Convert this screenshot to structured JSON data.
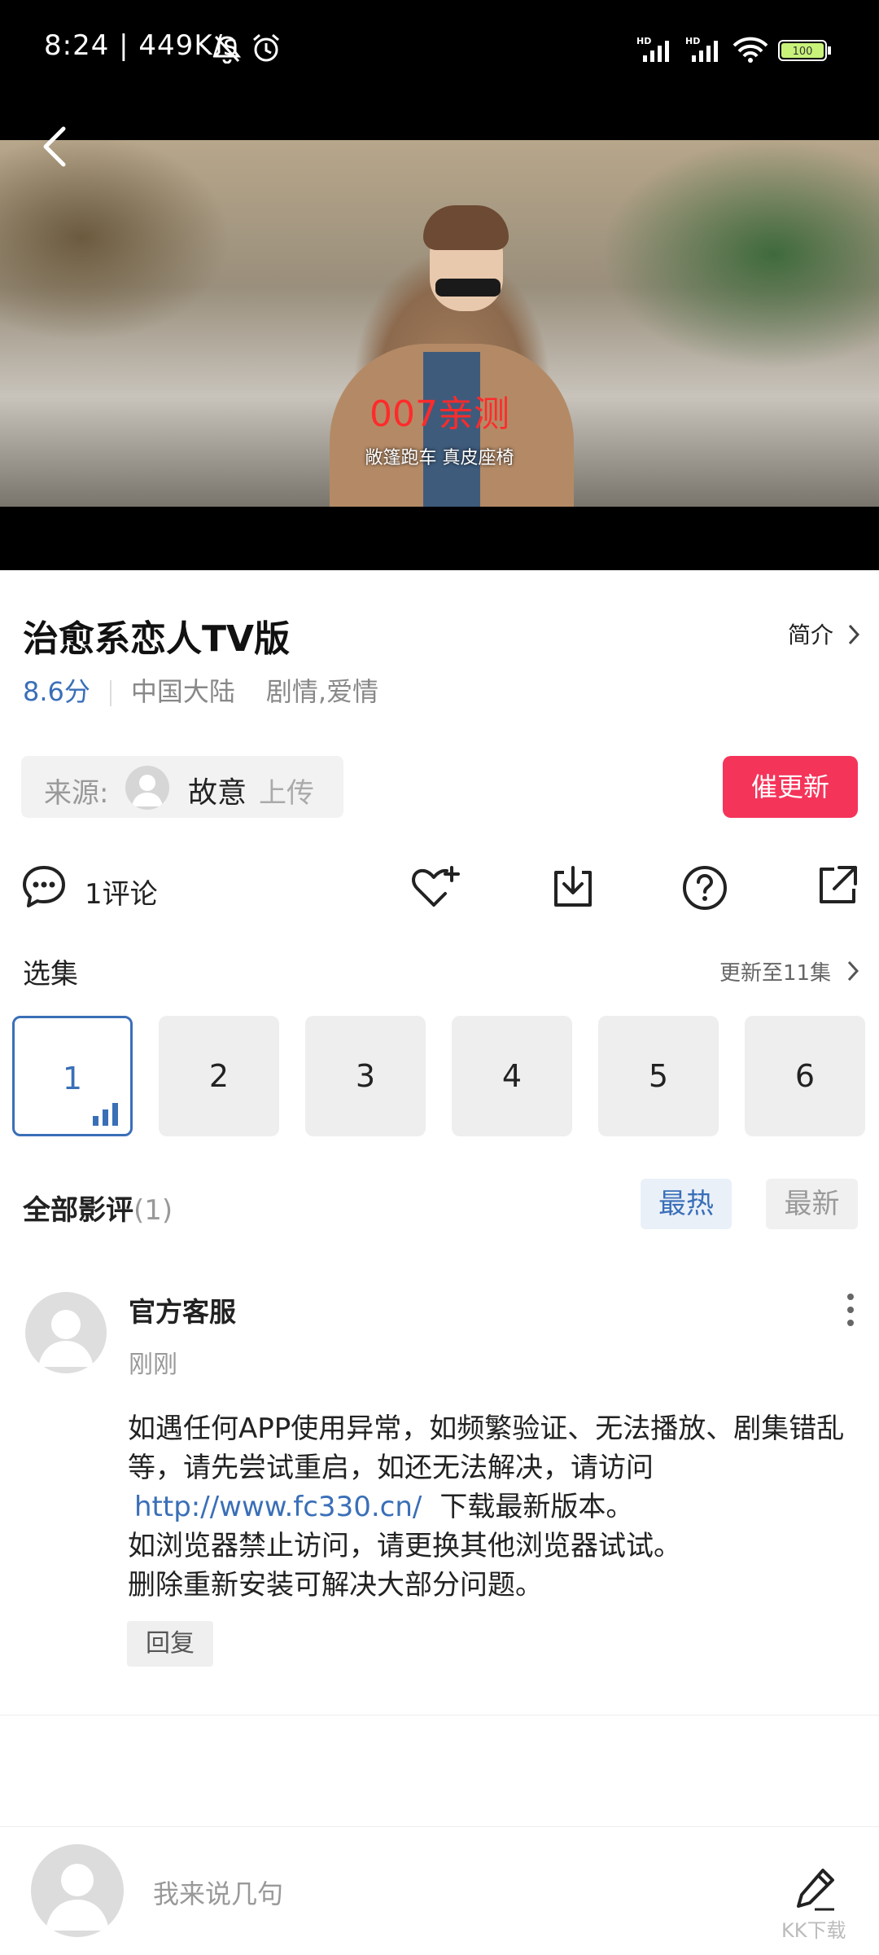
{
  "status_bar": {
    "time": "8:24 | 449K/s",
    "icons": [
      "mute-bell-icon",
      "alarm-icon",
      "hd-signal-icon",
      "hd-signal-icon",
      "wifi-icon",
      "battery-icon"
    ]
  },
  "video": {
    "overlay_text": "007亲测",
    "subtitle": "敞篷跑车 真皮座椅"
  },
  "title_section": {
    "title": "治愈系恋人TV版",
    "intro_label": "简介",
    "rating": "8.6分",
    "region": "中国大陆",
    "genres": "剧情,爱情"
  },
  "source": {
    "label": "来源:",
    "uploader": "故意",
    "upload_suffix": "上传"
  },
  "urge_update_label": "催更新",
  "actions": {
    "comments_label": "1评论",
    "icons": [
      "comment-icon",
      "favorite-add-icon",
      "download-icon",
      "help-icon",
      "share-icon"
    ]
  },
  "episodes": {
    "title": "选集",
    "update_status": "更新至11集",
    "items": [
      "1",
      "2",
      "3",
      "4",
      "5",
      "6"
    ],
    "selected": "1"
  },
  "reviews": {
    "title": "全部影评",
    "count": "(1)",
    "sort_hot": "最热",
    "sort_new": "最新",
    "active_sort": "最热"
  },
  "comment": {
    "author": "官方客服",
    "time": "刚刚",
    "text_1": "如遇任何APP使用异常，如频繁验证、无法播放、剧集错乱等，请先尝试重启，如还无法解决，请访问",
    "link": "http://www.fc330.cn/",
    "text_2": "下载最新版本。",
    "text_3": "如浏览器禁止访问，请更换其他浏览器试试。",
    "text_4": "删除重新安装可解决大部分问题。",
    "reply_label": "回复"
  },
  "bottom_bar": {
    "input_placeholder": "我来说几句",
    "watermark": "KK下载"
  },
  "colors": {
    "accent_blue": "#3a6fb8",
    "urge_red": "#f5345a"
  }
}
